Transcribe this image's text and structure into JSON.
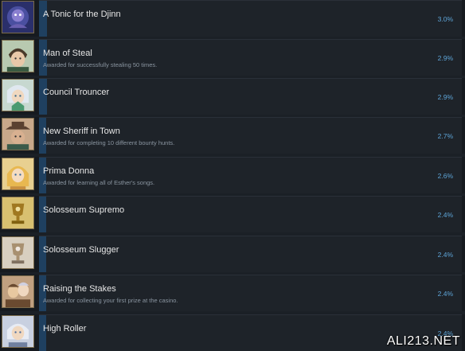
{
  "achievements": [
    {
      "name": "A Tonic for the Djinn",
      "description": "",
      "percent": "3.0%",
      "percent_value": 3.0,
      "icon": "djinn-portrait-icon",
      "icon_bg": "#2a2f6a",
      "icon_fg": "#8a7fd0"
    },
    {
      "name": "Man of Steal",
      "description": "Awarded for successfully stealing 50 times.",
      "percent": "2.9%",
      "percent_value": 2.9,
      "icon": "thief-portrait-icon",
      "icon_bg": "#b8c9b0",
      "icon_fg": "#6a5a3a"
    },
    {
      "name": "Council Trouncer",
      "description": "",
      "percent": "2.9%",
      "percent_value": 2.9,
      "icon": "elf-portrait-icon",
      "icon_bg": "#c7d8d0",
      "icon_fg": "#e0e8f0"
    },
    {
      "name": "New Sheriff in Town",
      "description": "Awarded for completing 10 different bounty hunts.",
      "percent": "2.7%",
      "percent_value": 2.7,
      "icon": "sheriff-portrait-icon",
      "icon_bg": "#c8a88a",
      "icon_fg": "#5a4030"
    },
    {
      "name": "Prima Donna",
      "description": "Awarded for learning all of Esther's songs.",
      "percent": "2.6%",
      "percent_value": 2.6,
      "icon": "singer-portrait-icon",
      "icon_bg": "#e8d090",
      "icon_fg": "#c89040"
    },
    {
      "name": "Solosseum Supremo",
      "description": "",
      "percent": "2.4%",
      "percent_value": 2.4,
      "icon": "gold-trophy-icon",
      "icon_bg": "#d8c070",
      "icon_fg": "#a07820"
    },
    {
      "name": "Solosseum Slugger",
      "description": "",
      "percent": "2.4%",
      "percent_value": 2.4,
      "icon": "silver-trophy-icon",
      "icon_bg": "#d8cfc0",
      "icon_fg": "#a89070"
    },
    {
      "name": "Raising the Stakes",
      "description": "Awarded for collecting your first prize at the casino.",
      "percent": "2.4%",
      "percent_value": 2.4,
      "icon": "casino-portrait-icon",
      "icon_bg": "#c0a080",
      "icon_fg": "#6a4a30"
    },
    {
      "name": "High Roller",
      "description": "",
      "percent": "2.4%",
      "percent_value": 2.4,
      "icon": "high-roller-portrait-icon",
      "icon_bg": "#c8d0e0",
      "icon_fg": "#7080a0"
    }
  ],
  "watermark": "ALI213.NET",
  "colors": {
    "fill": "#1f4060",
    "percent_text": "#5ea5d8",
    "row_bg": "#1e2329"
  }
}
